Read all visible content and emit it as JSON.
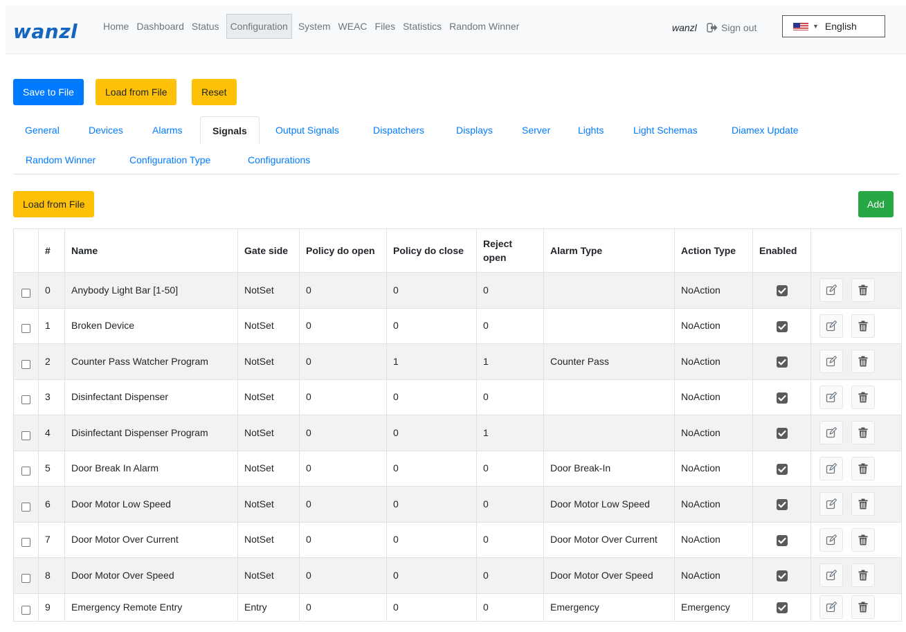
{
  "nav": {
    "brand": "wanzl",
    "links": [
      "Home",
      "Dashboard",
      "Status",
      "Configuration",
      "System",
      "WEAC",
      "Files",
      "Statistics",
      "Random Winner"
    ],
    "active": "Configuration",
    "user": "wanzl",
    "sign_out": "Sign out",
    "language": "English"
  },
  "toolbar": {
    "save_label": "Save to File",
    "load_label": "Load from File",
    "reset_label": "Reset"
  },
  "tabs": [
    "General",
    "Devices",
    "Alarms",
    "Signals",
    "Output Signals",
    "Dispatchers",
    "Displays",
    "Server",
    "Lights",
    "Light Schemas",
    "Diamex Update",
    "Random Winner",
    "Configuration Type",
    "Configurations"
  ],
  "active_tab": "Signals",
  "section": {
    "load_label": "Load from File",
    "add_label": "Add"
  },
  "table": {
    "headers": [
      "",
      "#",
      "Name",
      "Gate side",
      "Policy do open",
      "Policy do close",
      "Reject open",
      "Alarm Type",
      "Action Type",
      "Enabled",
      ""
    ],
    "rows": [
      [
        "0",
        "Anybody Light Bar [1-50]",
        "NotSet",
        "0",
        "0",
        "0",
        "",
        "NoAction",
        true
      ],
      [
        "1",
        "Broken Device",
        "NotSet",
        "0",
        "0",
        "0",
        "",
        "NoAction",
        true
      ],
      [
        "2",
        "Counter Pass Watcher Program",
        "NotSet",
        "0",
        "1",
        "1",
        "Counter Pass",
        "NoAction",
        true
      ],
      [
        "3",
        "Disinfectant Dispenser",
        "NotSet",
        "0",
        "0",
        "0",
        "",
        "NoAction",
        true
      ],
      [
        "4",
        "Disinfectant Dispenser Program",
        "NotSet",
        "0",
        "0",
        "1",
        "",
        "NoAction",
        true
      ],
      [
        "5",
        "Door Break In Alarm",
        "NotSet",
        "0",
        "0",
        "0",
        "Door Break-In",
        "NoAction",
        true
      ],
      [
        "6",
        "Door Motor Low Speed",
        "NotSet",
        "0",
        "0",
        "0",
        "Door Motor Low Speed",
        "NoAction",
        true
      ],
      [
        "7",
        "Door Motor Over Current",
        "NotSet",
        "0",
        "0",
        "0",
        "Door Motor Over Current",
        "NoAction",
        true
      ],
      [
        "8",
        "Door Motor Over Speed",
        "NotSet",
        "0",
        "0",
        "0",
        "Door Motor Over Speed",
        "NoAction",
        true
      ],
      [
        "9",
        "Emergency Remote Entry",
        "Entry",
        "0",
        "0",
        "0",
        "Emergency",
        "Emergency",
        true
      ]
    ]
  },
  "colors": {
    "primary": "#007bff",
    "warning": "#ffc107",
    "success": "#28a745",
    "brand": "#1565c0"
  }
}
